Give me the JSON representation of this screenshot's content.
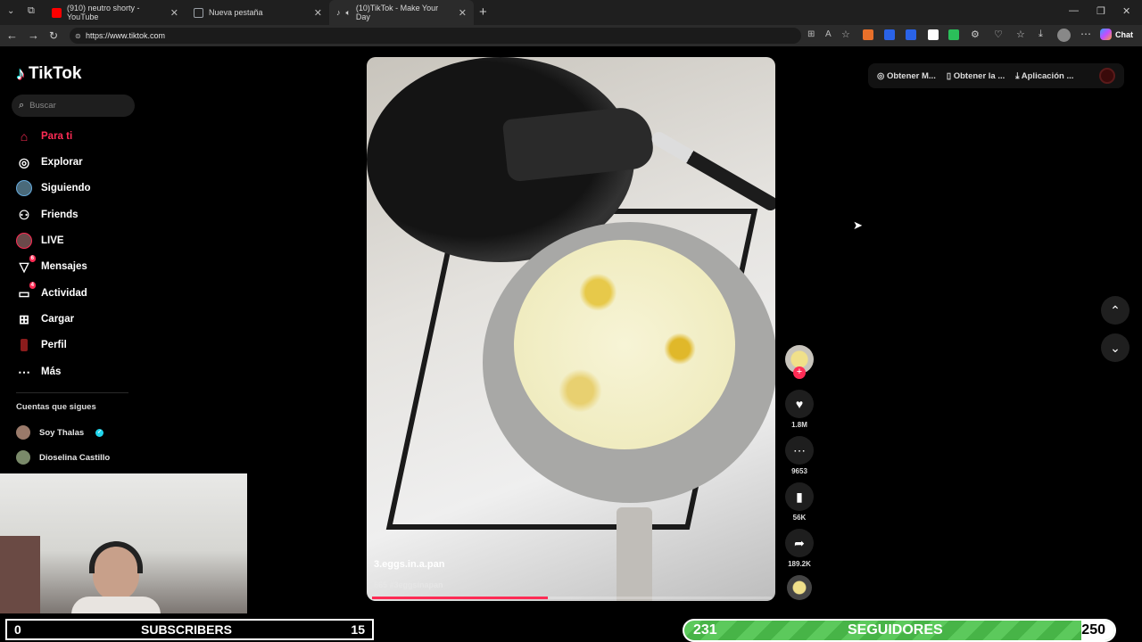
{
  "browser": {
    "tabs": [
      {
        "label": "(910) neutro shorty - YouTube",
        "favicon_color": "#ff0000"
      },
      {
        "label": "Nueva pestaña",
        "favicon_color": "#9aa0a6"
      },
      {
        "label": "(10)TikTok - Make Your Day",
        "favicon_color": "#000000"
      }
    ],
    "url": "https://www.tiktok.com",
    "copilot_label": "Chat"
  },
  "tiktok": {
    "logo_text": "TikTok",
    "search_placeholder": "Buscar",
    "nav": [
      {
        "label": "Para ti",
        "icon": "home-icon",
        "active": true
      },
      {
        "label": "Explorar",
        "icon": "compass-icon"
      },
      {
        "label": "Siguiendo",
        "icon": "following-avatar-icon"
      },
      {
        "label": "Friends",
        "icon": "friends-icon"
      },
      {
        "label": "LIVE",
        "icon": "live-icon"
      },
      {
        "label": "Mensajes",
        "icon": "messages-icon",
        "badge": "6"
      },
      {
        "label": "Actividad",
        "icon": "activity-icon",
        "badge": "4"
      },
      {
        "label": "Cargar",
        "icon": "upload-icon"
      },
      {
        "label": "Perfil",
        "icon": "profile-icon"
      },
      {
        "label": "Más",
        "icon": "more-icon"
      }
    ],
    "following_title": "Cuentas que sigues",
    "following": [
      {
        "name": "Soy Thalas",
        "verified": true
      },
      {
        "name": "Dioselina Castillo",
        "verified": false
      }
    ],
    "video": {
      "caption": "3.eggs.in.a.pan",
      "tags": "665 #3eggsinapan",
      "progress": 0.44
    },
    "actions": {
      "likes": "1.8M",
      "comments": "9653",
      "saves": "56K",
      "shares": "189.2K"
    },
    "topbar": [
      "Obtener M...",
      "Obtener la ...",
      "Aplicación ..."
    ]
  },
  "stream": {
    "subs_count": "0",
    "subs_label": "SUBSCRIBERS",
    "subs_goal": "15",
    "followers_count": "231",
    "followers_label": "SEGUIDORES",
    "followers_goal": "250"
  },
  "colors": {
    "accent": "#fe2c55",
    "goal_green": "#5cc95c"
  }
}
